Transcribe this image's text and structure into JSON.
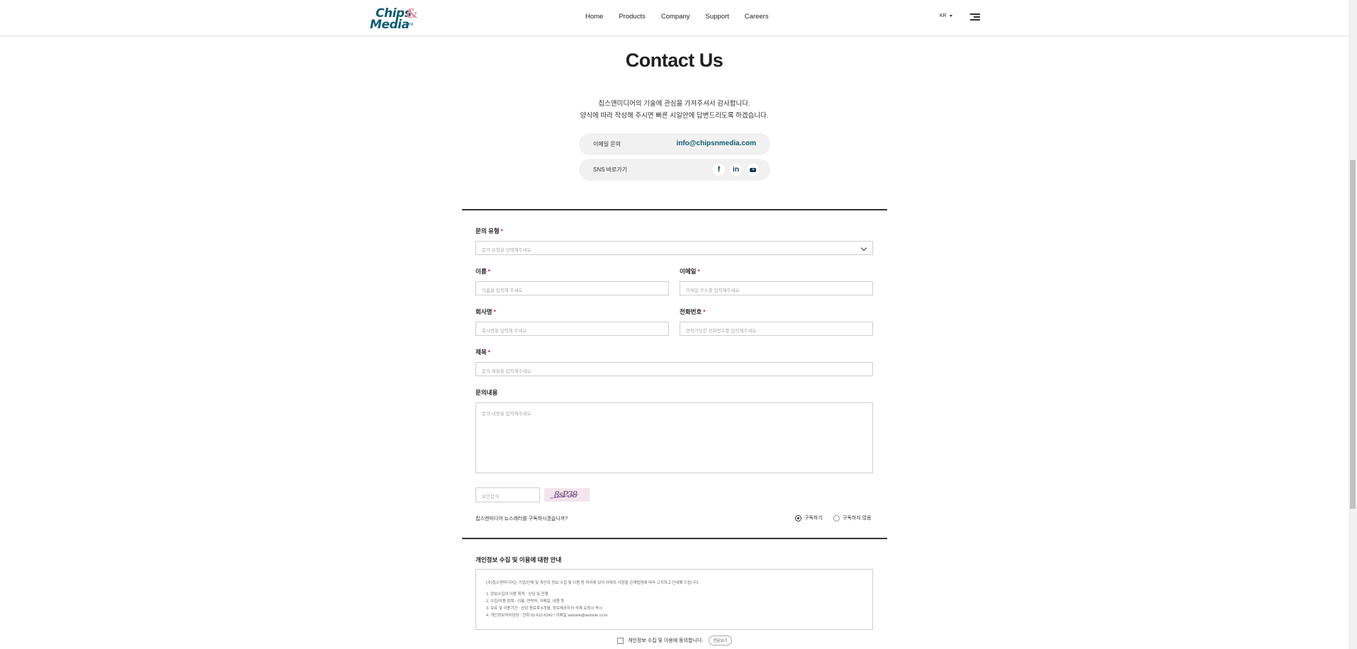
{
  "header": {
    "logo_line1": "Chips",
    "logo_line2": "Media",
    "logo_amp": "&",
    "logo_tm": "TM",
    "nav": [
      "Home",
      "Products",
      "Company",
      "Support",
      "Careers"
    ],
    "lang": "KR"
  },
  "hero": {
    "title": "Contact Us",
    "intro_line1": "칩스앤미디어의 기술에 관심을 가져주셔서 감사합니다.",
    "intro_line2": "양식에 따라 작성해 주시면 빠른 시일안에 답변드리도록 하겠습니다."
  },
  "contact": {
    "email_label": "이메일 문의",
    "email": "info@chipsnmedia.com",
    "sns_label": "SNS 바로가기",
    "sns_icons": [
      "facebook-icon",
      "linkedin-icon",
      "youtube-icon"
    ]
  },
  "form": {
    "type_label": "문의 유형",
    "type_placeholder": "문의 유형을 선택해주세요",
    "name_label": "이름",
    "name_placeholder": "이름을 입력해 주세요",
    "email_label": "이메일",
    "email_placeholder": "이메일 주소를 입력해주세요",
    "company_label": "회사명",
    "company_placeholder": "회사명을 입력해 주세요",
    "phone_label": "전화번호",
    "phone_placeholder": "연락가능한 전화번호를 입력해주세요",
    "subject_label": "제목",
    "subject_placeholder": "문의 제목을 입력해주세요",
    "content_label": "문의내용",
    "content_placeholder": "문의 내용을 입력해주세요",
    "captcha_placeholder": "보안문자",
    "captcha_text": "8sP38",
    "required_mark": "*",
    "newsletter_question": "칩스앤미디어 뉴스레터를 구독하시겠습니까?",
    "newsletter_yes": "구독하기",
    "newsletter_no": "구독하지 않음",
    "newsletter_selected": "구독하기"
  },
  "privacy": {
    "title": "개인정보 수집 및 이용에 대한 안내",
    "intro": "(주)칩스앤미디어는 기업/단체 및 개인의 정보 수집 및 이용 등 처리에 있어 아래의 사항을 관계법령에 따라 고지하고 안내해 드립니다.",
    "items": [
      "1. 정보수집의 이용 목적 : 상담 및 진행",
      "2. 수집/이용 항목 : 이름, 연락처, 이메일, 내용 등",
      "3. 보유 및 이용기간 : 상담 종료후 6개월, 정보제공자의 삭제 요청시 즉시",
      "4. 개인정보처리담당 : 전화 02-612-6242 / 이메일 website@website.co.kr"
    ],
    "agree_label": "개인정보 수집 및 이용에 동의합니다.",
    "view_all": "전문보기"
  }
}
